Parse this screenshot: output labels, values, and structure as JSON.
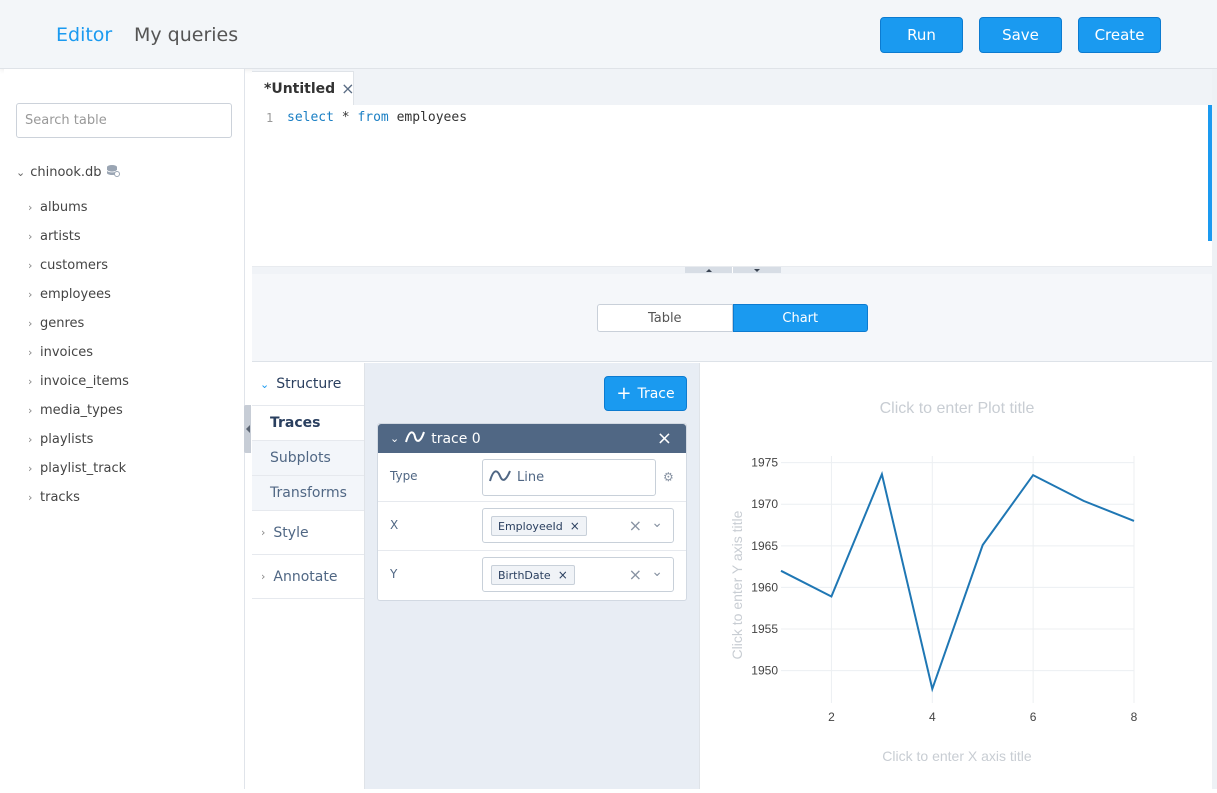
{
  "header": {
    "nav": [
      "Editor",
      "My queries"
    ],
    "buttons": {
      "run": "Run",
      "save": "Save",
      "create": "Create"
    }
  },
  "sidebar": {
    "search_placeholder": "Search table",
    "database": "chinook.db",
    "tables": [
      "albums",
      "artists",
      "customers",
      "employees",
      "genres",
      "invoices",
      "invoice_items",
      "media_types",
      "playlists",
      "playlist_track",
      "tracks"
    ]
  },
  "editor": {
    "tab_title": "*Untitled",
    "line_number": "1",
    "query": {
      "kw1": "select",
      "star": " * ",
      "kw2": "from",
      "rest": " employees"
    }
  },
  "results": {
    "table_label": "Table",
    "chart_label": "Chart",
    "active": "Chart"
  },
  "panel": {
    "structure": "Structure",
    "subsections": [
      "Traces",
      "Subplots",
      "Transforms"
    ],
    "active_sub": "Traces",
    "groups": [
      "Style",
      "Annotate"
    ]
  },
  "trace": {
    "add_button": "Trace",
    "name": "trace 0",
    "type_label": "Type",
    "type_value": "Line",
    "x_label": "X",
    "x_value": "EmployeeId",
    "y_label": "Y",
    "y_value": "BirthDate"
  },
  "colors": {
    "accent": "#1a9af0",
    "trace_header": "#506784",
    "line": "#1f77b4"
  },
  "chart_data": {
    "type": "line",
    "title": "Click to enter Plot title",
    "xlabel": "Click to enter X axis title",
    "ylabel": "Click to enter Y axis title",
    "x": [
      1,
      2,
      3,
      4,
      5,
      6,
      7,
      8
    ],
    "series": [
      {
        "values": [
          1962.0,
          1958.9,
          1973.6,
          1947.8,
          1965.1,
          1973.5,
          1970.4,
          1968.0
        ]
      }
    ],
    "xlim": [
      1,
      8
    ],
    "ylim": [
      1946.1,
      1975.8
    ],
    "xticks": [
      2,
      4,
      6,
      8
    ],
    "yticks": [
      1950,
      1955,
      1960,
      1965,
      1970,
      1975
    ],
    "grid": true
  }
}
